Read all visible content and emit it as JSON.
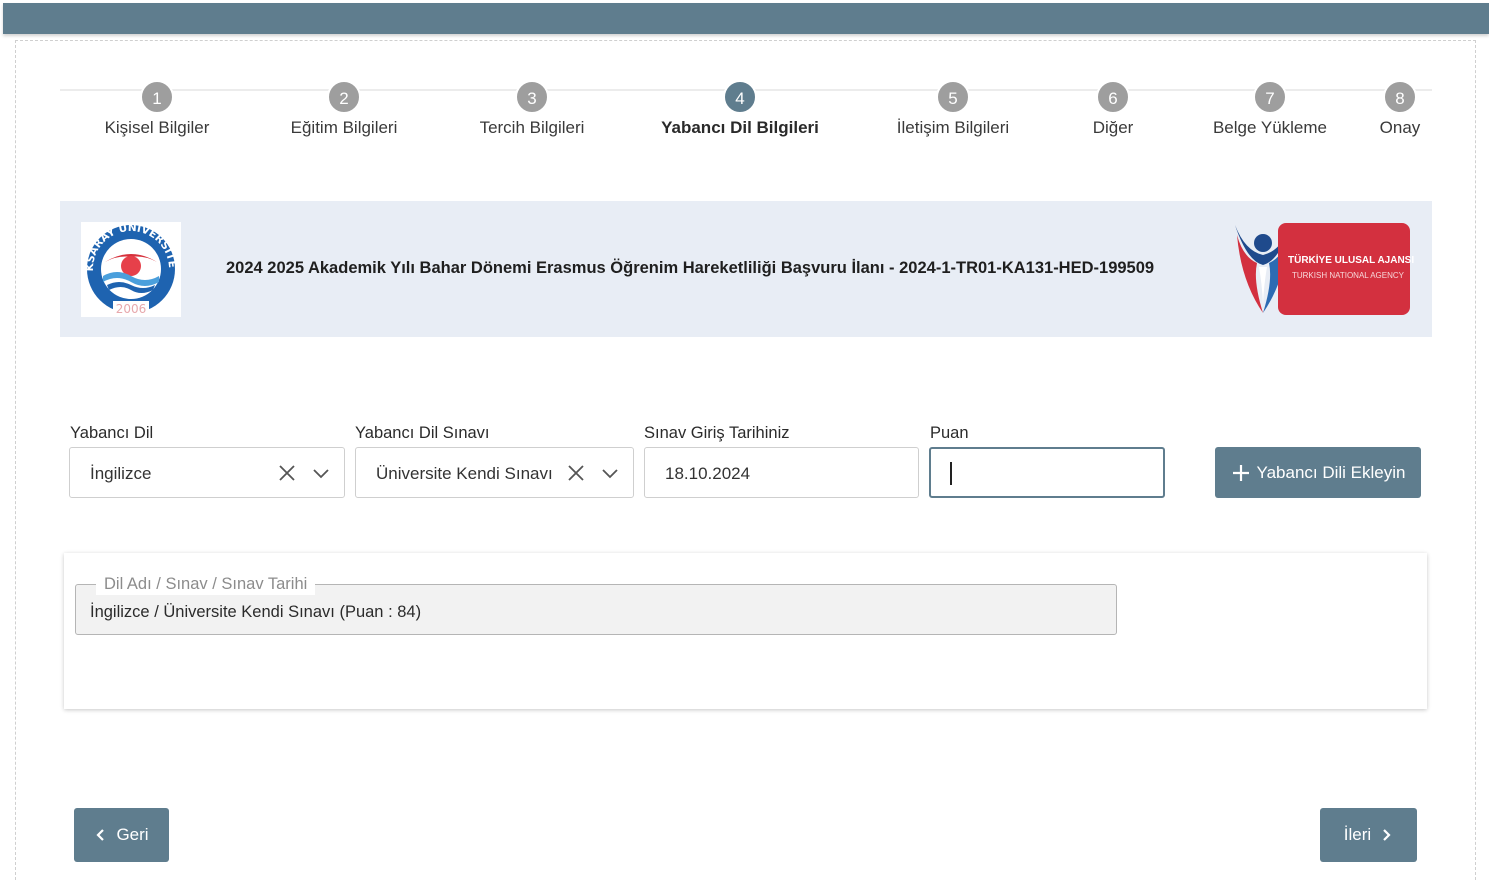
{
  "steps": [
    {
      "number": "1",
      "label": "Kişisel Bilgiler"
    },
    {
      "number": "2",
      "label": "Eğitim Bilgileri"
    },
    {
      "number": "3",
      "label": "Tercih Bilgileri"
    },
    {
      "number": "4",
      "label": "Yabancı Dil Bilgileri"
    },
    {
      "number": "5",
      "label": "İletişim Bilgileri"
    },
    {
      "number": "6",
      "label": "Diğer"
    },
    {
      "number": "7",
      "label": "Belge Yükleme"
    },
    {
      "number": "8",
      "label": "Onay"
    }
  ],
  "active_step": 4,
  "banner": {
    "title": "2024 2025 Akademik Yılı Bahar Dönemi Erasmus Öğrenim Hareketliliği Başvuru İlanı - 2024-1-TR01-KA131-HED-199509",
    "university_logo_text": "AKSARAY ÜNİVERSİTESİ",
    "university_logo_year": "2006",
    "agency_logo_text": "TÜRKİYE ULUSAL AJANSI",
    "agency_logo_subtext": "TURKISH NATIONAL AGENCY"
  },
  "form": {
    "language": {
      "label": "Yabancı Dil",
      "value": "İngilizce"
    },
    "exam": {
      "label": "Yabancı Dil Sınavı",
      "value": "Üniversite Kendi Sınavı"
    },
    "exam_date": {
      "label": "Sınav Giriş Tarihiniz",
      "value": "18.10.2024"
    },
    "score": {
      "label": "Puan",
      "value": ""
    },
    "add_button": "Yabancı Dili Ekleyin"
  },
  "list": {
    "legend": "Dil Adı / Sınav / Sınav Tarihi",
    "entries": [
      "İngilizce / Üniversite Kendi Sınavı (Puan : 84)"
    ]
  },
  "nav": {
    "back": "Geri",
    "next": "İleri"
  },
  "colors": {
    "primary": "#5f7d8e",
    "step_inactive": "#9e9e9e",
    "banner_bg": "#e8edf5",
    "agency_red": "#d3303f"
  }
}
